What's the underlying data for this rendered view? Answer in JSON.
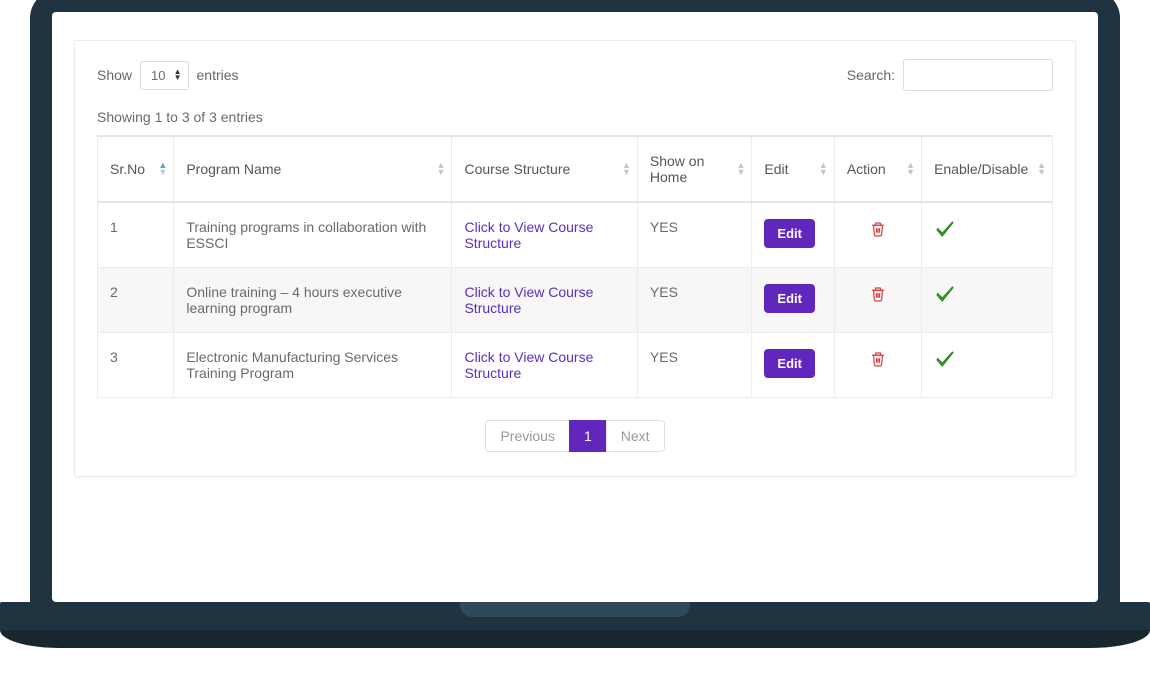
{
  "length_control": {
    "prefix": "Show",
    "value": "10",
    "suffix": "entries"
  },
  "search_control": {
    "label": "Search:",
    "value": ""
  },
  "info_text": "Showing 1 to 3 of 3 entries",
  "columns": {
    "sr": "Sr.No",
    "name": "Program Name",
    "struct": "Course Structure",
    "home": "Show on Home",
    "edit": "Edit",
    "action": "Action",
    "enable": "Enable/Disable"
  },
  "struct_link_label": "Click to View Course Structure",
  "edit_label": "Edit",
  "rows": [
    {
      "sr": "1",
      "name": "Training programs in collaboration with ESSCI",
      "home": "YES"
    },
    {
      "sr": "2",
      "name": "Online training – 4 hours executive learning program",
      "home": "YES"
    },
    {
      "sr": "3",
      "name": "Electronic Manufacturing Services Training Program",
      "home": "YES"
    }
  ],
  "pagination": {
    "prev": "Previous",
    "current": "1",
    "next": "Next"
  }
}
